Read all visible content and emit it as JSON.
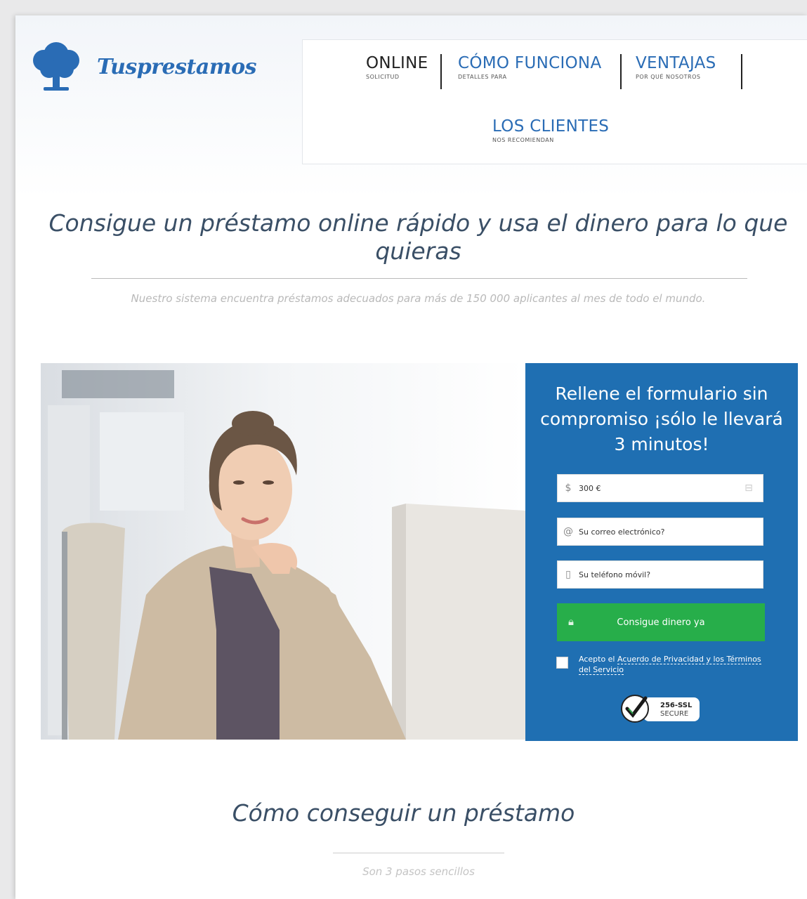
{
  "brand": {
    "name": "Tusprestamos",
    "color": "#2a6cb5"
  },
  "nav": {
    "items": [
      {
        "label": "ONLINE",
        "sub": "SOLICITUD",
        "active": true
      },
      {
        "label": "CÓMO FUNCIONA",
        "sub": "DETALLES PARA"
      },
      {
        "label": "VENTAJAS",
        "sub": "POR QUÉ NOSOTROS"
      },
      {
        "label": "LOS CLIENTES",
        "sub": "NOS RECOMIENDAN"
      }
    ]
  },
  "hero": {
    "headline": "Consigue un préstamo online rápido y usa el dinero para lo que quieras",
    "subline": "Nuestro sistema encuentra préstamos adecuados para más de 150 000 aplicantes al mes de todo el mundo."
  },
  "form": {
    "title": "Rellene el formulario sin compromiso ¡sólo le llevará 3 minutos!",
    "amount": {
      "icon": "$",
      "value": "300 €"
    },
    "email_placeholder": "Su correo electrónico?",
    "phone_placeholder": "Su teléfono móvil?",
    "submit_label": "Consigue dinero ya",
    "agree_prefix": "Acepto el ",
    "agree_link": "Acuerdo de Privacidad y los Términos del Servicio",
    "ssl": {
      "line1": "256-SSL",
      "line2": "SECURE"
    },
    "panel_color": "#1f6fb2",
    "button_color": "#27ae4a"
  },
  "how": {
    "title": "Cómo conseguir un préstamo",
    "subtitle": "Son 3 pasos sencillos"
  }
}
